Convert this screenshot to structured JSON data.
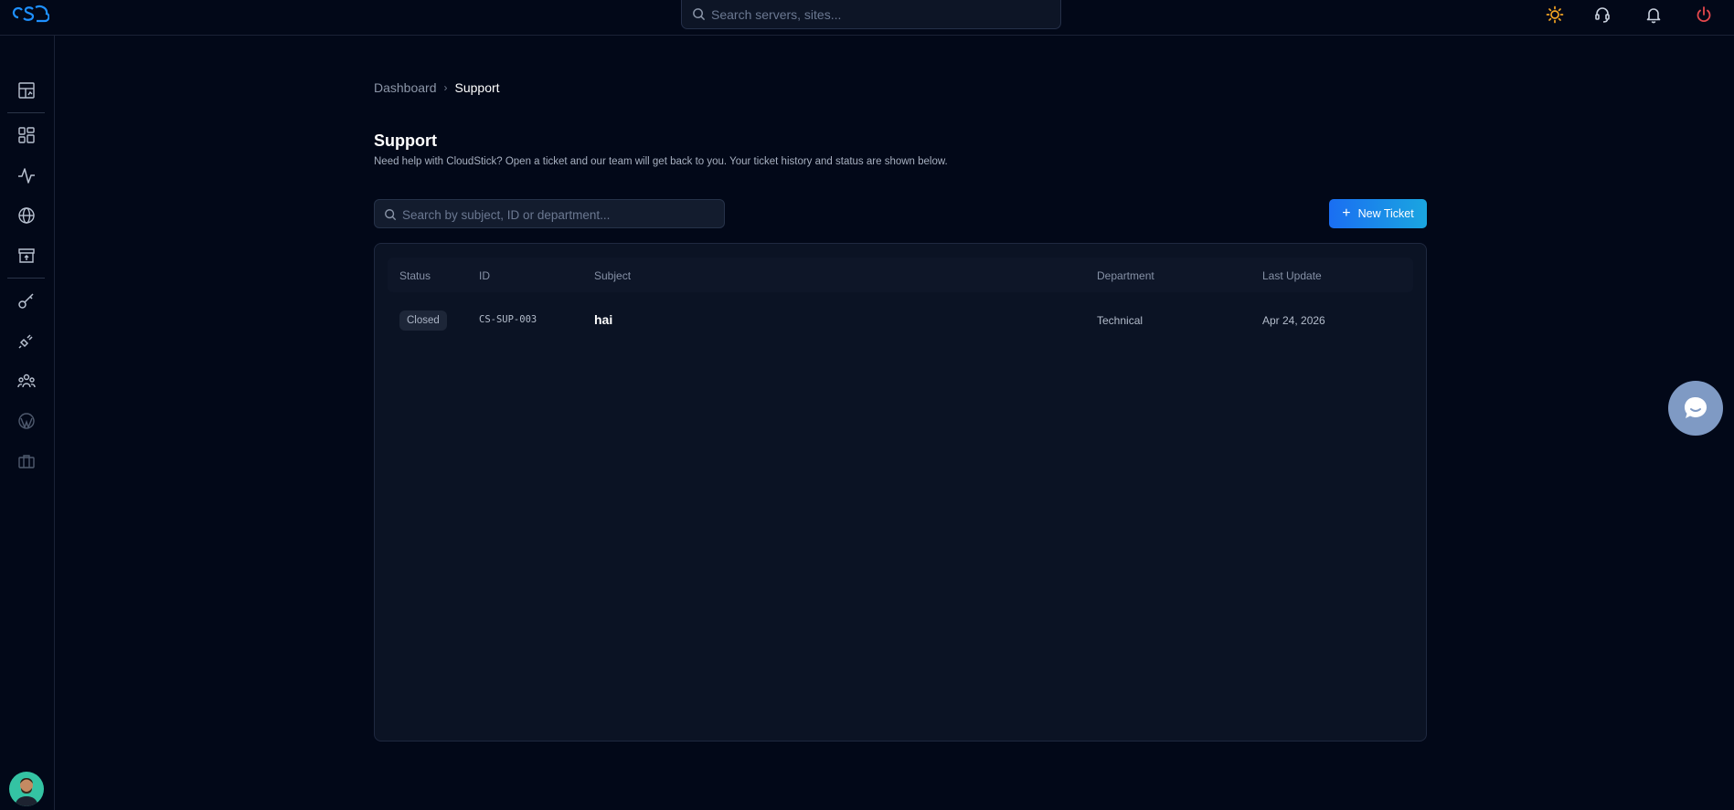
{
  "app": {
    "logo_text": "cS"
  },
  "top_search": {
    "placeholder": "Search servers, sites..."
  },
  "top_icons": [
    "sun-icon",
    "headset-icon",
    "bell-icon",
    "power-icon"
  ],
  "sidebar": {
    "items": [
      "dashboard-icon",
      "apps-grid-icon",
      "activity-icon",
      "globe-icon",
      "store-icon",
      "key-icon",
      "plug-icon",
      "team-icon",
      "wordpress-icon",
      "briefcase-icon"
    ]
  },
  "breadcrumb": {
    "parent": "Dashboard",
    "current": "Support"
  },
  "page": {
    "title": "Support",
    "description": "Need help with CloudStick? Open a ticket and our team will get back to you. Your ticket history and status are shown below."
  },
  "ticket_search": {
    "placeholder": "Search by subject, ID or department..."
  },
  "new_ticket_label": "New Ticket",
  "table": {
    "headers": {
      "status": "Status",
      "id": "ID",
      "subject": "Subject",
      "department": "Department",
      "last_update": "Last Update"
    },
    "rows": [
      {
        "status": "Closed",
        "id": "CS-SUP-003",
        "subject": "hai",
        "department": "Technical",
        "last_update": "Apr 24, 2026"
      }
    ]
  },
  "colors": {
    "accent": "#1a8cf0",
    "power": "#e5484d",
    "sun": "#f5a623",
    "background": "#020818"
  }
}
